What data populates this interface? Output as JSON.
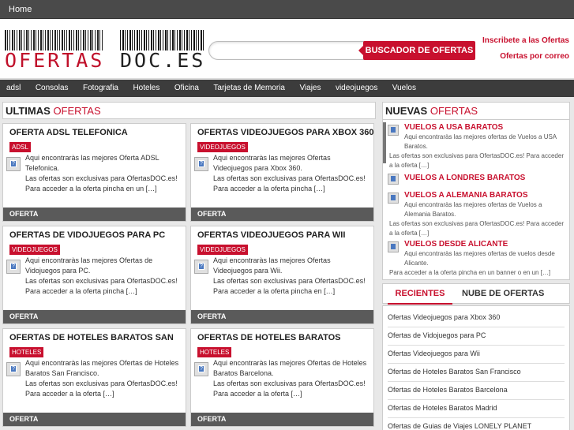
{
  "topbar": {
    "home": "Home"
  },
  "logo": {
    "part1": "OFERTAS",
    "part2": "DOC.ES"
  },
  "search": {
    "placeholder": "",
    "button": "BUSCADOR DE OFERTAS"
  },
  "header_links": {
    "subscribe": "Inscribete a las Ofertas",
    "email": "Ofertas por correo"
  },
  "nav": [
    "adsl",
    "Consolas",
    "Fotografia",
    "Hoteles",
    "Oficina",
    "Tarjetas de Memoria",
    "Viajes",
    "videojuegos",
    "Vuelos"
  ],
  "ultimas": {
    "head1": "ULTIMAS",
    "head2": "OFERTAS"
  },
  "cards": [
    {
      "title": "OFERTA ADSL TELEFONICA",
      "badge": "ADSL",
      "line1": "Aqui encontraràs las mejores Oferta ADSL Telefonica.",
      "line2": "Las ofertas son exclusivas para OfertasDOC.es! Para acceder a la oferta pincha en un […]",
      "foot": "OFERTA"
    },
    {
      "title": "OFERTAS VIDEOJUEGOS PARA XBOX 360",
      "badge": "VIDEOJUEGOS",
      "line1": "Aqui encontraràs las mejores Ofertas Videojuegos para Xbox 360.",
      "line2": "Las ofertas son exclusivas para OfertasDOC.es! Para acceder a la oferta pincha […]",
      "foot": "OFERTA"
    },
    {
      "title": "OFERTAS DE VIDOJUEGOS PARA PC",
      "badge": "VIDEOJUEGOS",
      "line1": "Aqui encontraràs las mejores Ofertas de Vidojuegos para PC.",
      "line2": "Las ofertas son exclusivas para OfertasDOC.es! Para acceder a la oferta pincha […]",
      "foot": "OFERTA"
    },
    {
      "title": "OFERTAS VIDEOJUEGOS PARA WII",
      "badge": "VIDEOJUEGOS",
      "line1": "Aqui encontraràs las mejores Ofertas Videojuegos para Wii.",
      "line2": "Las ofertas son exclusivas para OfertasDOC.es! Para acceder a la oferta pincha en […]",
      "foot": "OFERTA"
    },
    {
      "title": "OFERTAS DE HOTELES BARATOS SAN",
      "badge": "HOTELES",
      "line1": "Aqui encontraràs las mejores Ofertas de Hoteles Baratos San Francisco.",
      "line2": "Las ofertas son exclusivas para OfertasDOC.es! Para acceder a la oferta […]",
      "foot": "OFERTA"
    },
    {
      "title": "OFERTAS DE HOTELES BARATOS",
      "badge": "HOTELES",
      "line1": "Aqui encontraràs las mejores Ofertas de Hoteles Baratos Barcelona.",
      "line2": "Las ofertas son exclusivas para OfertasDOC.es! Para acceder a la oferta […]",
      "foot": "OFERTA"
    }
  ],
  "nuevas": {
    "head1": "NUEVAS",
    "head2": "OFERTAS",
    "items": [
      {
        "title": "VUELOS A USA BARATOS",
        "text1": "Aqui encontraràs las mejores ofertas de Vuelos a USA Baratos.",
        "text2": "Las ofertas son exclusivas para OfertasDOC.es! Para acceder a la oferta […]"
      },
      {
        "title": "VUELOS A LONDRES BARATOS",
        "text1": "",
        "text2": ""
      },
      {
        "title": "VUELOS A ALEMANIA BARATOS",
        "text1": "Aqui encontraràs las mejores ofertas de Vuelos a Alemania Baratos.",
        "text2": "Las ofertas son exclusivas para OfertasDOC.es! Para acceder a la oferta […]"
      },
      {
        "title": "VUELOS DESDE ALICANTE",
        "text1": "Aqui encontraràs las mejores ofertas de vuelos desde Alicante.",
        "text2": "Para acceder a la oferta pincha en un banner o en un […]"
      }
    ]
  },
  "tabs": {
    "recientes": "RECIENTES",
    "nube": "NUBE DE OFERTAS"
  },
  "recent_list": [
    "Ofertas Videojuegos para Xbox 360",
    "Ofertas de Vidojuegos para PC",
    "Ofertas Videojuegos para Wii",
    "Ofertas de Hoteles Baratos San Francisco",
    "Ofertas de Hoteles Baratos Barcelona",
    "Ofertas de Hoteles Baratos Madrid",
    "Ofertas de Guias de Viajes LONELY PLANET"
  ]
}
